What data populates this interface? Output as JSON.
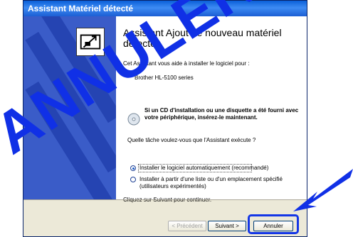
{
  "window": {
    "title": "Assistant Matériel détecté"
  },
  "content": {
    "heading": "Assistant Ajout de nouveau matériel détecté",
    "intro": "Cet Assistant vous aide à installer le logiciel pour :",
    "device": "Brother HL-5100 series",
    "cd_text": "Si un CD d'installation ou une disquette a été fourni avec votre périphérique, insérez-le maintenant.",
    "question": "Quelle tâche voulez-vous que l'Assistant exécute ?",
    "options": [
      {
        "label": "Installer le logiciel automatiquement (recommandé)",
        "checked": true
      },
      {
        "label": "Installer à partir d'une liste ou d'un emplacement spécifié (utilisateurs expérimentés)",
        "checked": false
      }
    ],
    "footer_note": "Cliquez sur Suivant pour continuer."
  },
  "buttons": {
    "previous": "< Précédent",
    "next": "Suivant >",
    "cancel": "Annuler"
  },
  "overlay": {
    "stamp": "ANNULER",
    "color": "#1030e6"
  }
}
